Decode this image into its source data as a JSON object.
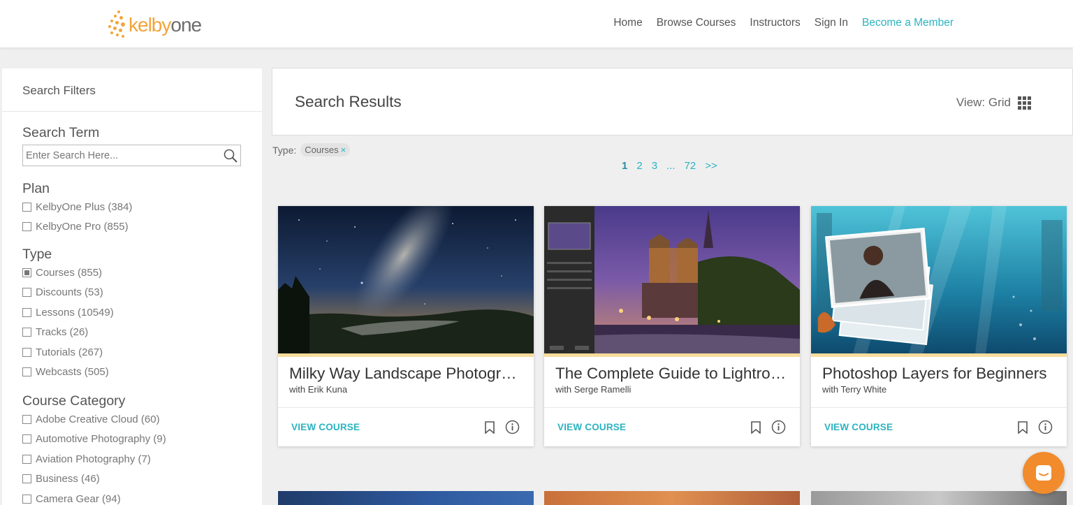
{
  "brand": {
    "logo_part1": "kelby",
    "logo_part2": "one",
    "accent": "#2bb3c0",
    "logo_color": "#f3a43a"
  },
  "nav": [
    {
      "label": "Home"
    },
    {
      "label": "Browse Courses"
    },
    {
      "label": "Instructors"
    },
    {
      "label": "Sign In"
    },
    {
      "label": "Become a Member"
    }
  ],
  "sidebar": {
    "title": "Search Filters",
    "search": {
      "title": "Search Term",
      "placeholder": "Enter Search Here...",
      "value": ""
    },
    "plan": {
      "title": "Plan",
      "options": [
        {
          "label": "KelbyOne Plus (384)",
          "checked": false
        },
        {
          "label": "KelbyOne Pro (855)",
          "checked": false
        }
      ]
    },
    "type": {
      "title": "Type",
      "options": [
        {
          "label": "Courses (855)",
          "checked": true
        },
        {
          "label": "Discounts (53)",
          "checked": false
        },
        {
          "label": "Lessons (10549)",
          "checked": false
        },
        {
          "label": "Tracks (26)",
          "checked": false
        },
        {
          "label": "Tutorials (267)",
          "checked": false
        },
        {
          "label": "Webcasts (505)",
          "checked": false
        }
      ]
    },
    "category": {
      "title": "Course Category",
      "options": [
        {
          "label": "Adobe Creative Cloud (60)",
          "checked": false
        },
        {
          "label": "Automotive Photography (9)",
          "checked": false
        },
        {
          "label": "Aviation Photography (7)",
          "checked": false
        },
        {
          "label": "Business (46)",
          "checked": false
        },
        {
          "label": "Camera Gear (94)",
          "checked": false
        }
      ]
    }
  },
  "results": {
    "title": "Search Results",
    "view_label": "View: Grid",
    "type_label": "Type:",
    "type_chip": "Courses",
    "chip_remove": "×",
    "pagination": [
      "1",
      "2",
      "3",
      "...",
      "72",
      ">>"
    ]
  },
  "cards": [
    {
      "title": "Milky Way Landscape Photography",
      "author": "with Erik Kuna",
      "action": "VIEW COURSE"
    },
    {
      "title": "The Complete Guide to Lightroom Classic",
      "author": "with Serge Ramelli",
      "action": "VIEW COURSE"
    },
    {
      "title": "Photoshop Layers for Beginners",
      "author": "with Terry White",
      "action": "VIEW COURSE"
    }
  ],
  "icons": {
    "search": "search-icon",
    "grid": "grid-icon",
    "bookmark": "bookmark-icon",
    "info": "info-icon",
    "chat": "chat-icon"
  }
}
